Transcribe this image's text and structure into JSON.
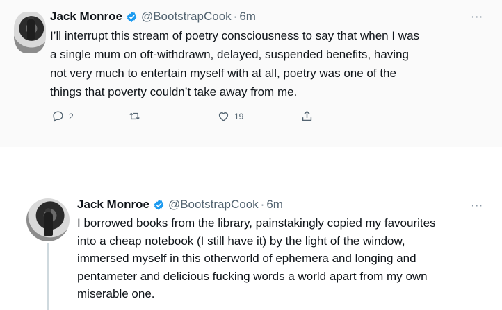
{
  "tweets": [
    {
      "author_name": "Jack Monroe",
      "handle": "@BootstrapCook",
      "separator": "·",
      "time": "6m",
      "more_label": "···",
      "lines": [
        "I’ll interrupt this stream of poetry consciousness to say that when I was",
        "a single mum on oft-withdrawn, delayed, suspended benefits, having",
        "not very much to entertain myself with at all, poetry was one of the",
        "things that poverty couldn’t take away from me."
      ],
      "reply_count": "2",
      "retweet_count": "",
      "like_count": "19",
      "share_count": ""
    },
    {
      "author_name": "Jack Monroe",
      "handle": "@BootstrapCook",
      "separator": "·",
      "time": "6m",
      "more_label": "···",
      "lines": [
        "I borrowed books from the library, painstakingly copied my favourites",
        "into a cheap notebook (I still have it) by the light of the window,",
        "immersed myself in this otherworld of ephemera and longing and",
        "pentameter and delicious fucking words a world apart from my own",
        "miserable one."
      ]
    }
  ],
  "colors": {
    "verified": "#1d9bf0",
    "secondary_text": "#536471",
    "primary_text": "#0f1419"
  },
  "icons": {
    "reply": "reply-icon",
    "retweet": "retweet-icon",
    "like": "heart-icon",
    "share": "share-icon",
    "verified": "verified-badge-icon"
  }
}
